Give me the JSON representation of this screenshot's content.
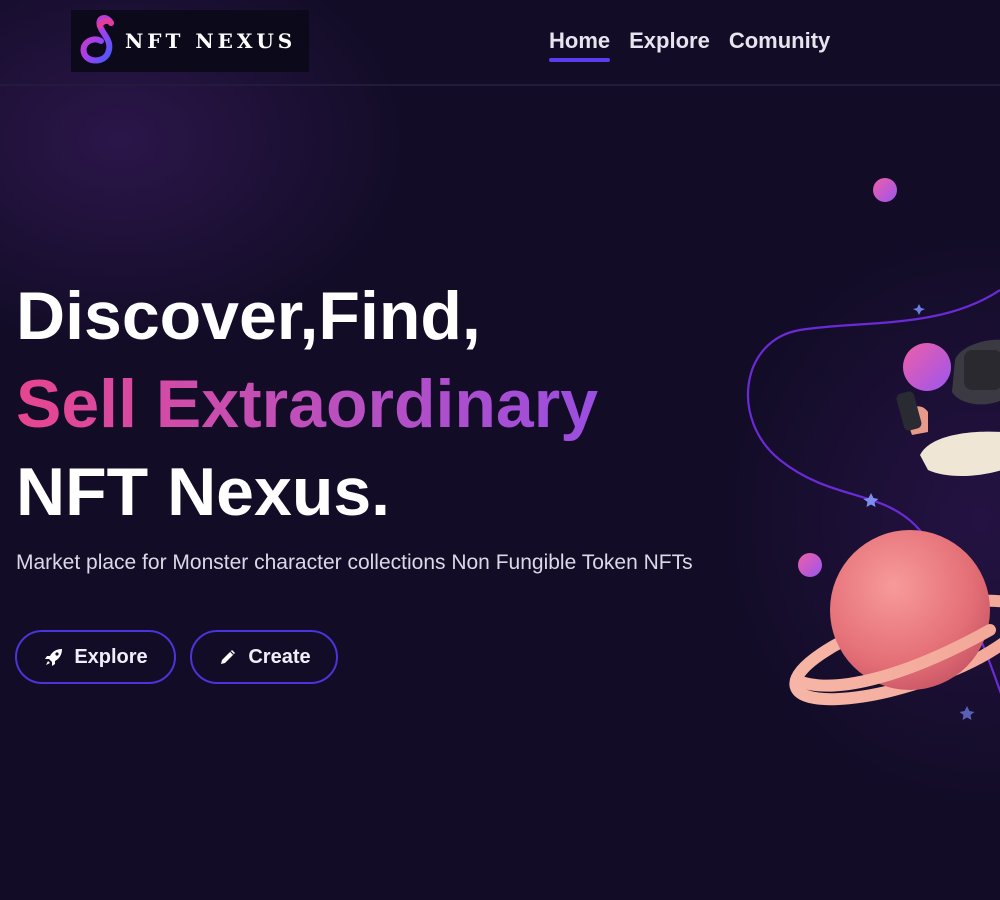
{
  "brand": {
    "name": "NFT NEXUS",
    "logo_icon": "infinity-loop-icon"
  },
  "nav": {
    "items": [
      {
        "label": "Home",
        "active": true
      },
      {
        "label": "Explore",
        "active": false
      },
      {
        "label": "Comunity",
        "active": false
      }
    ]
  },
  "hero": {
    "title_line1": "Discover,Find,",
    "title_line2": "Sell Extraordinary",
    "title_line3": "NFT Nexus.",
    "subtitle": "Market place for Monster character collections Non Fungible Token NFTs"
  },
  "buttons": {
    "explore": {
      "label": "Explore",
      "icon": "rocket-icon"
    },
    "create": {
      "label": "Create",
      "icon": "pencil-icon"
    }
  },
  "colors": {
    "background": "#120c26",
    "accent": "#5b3df0",
    "gradient_start": "#e7458f",
    "gradient_end": "#9a4ee0",
    "button_border": "#4b34d9"
  }
}
